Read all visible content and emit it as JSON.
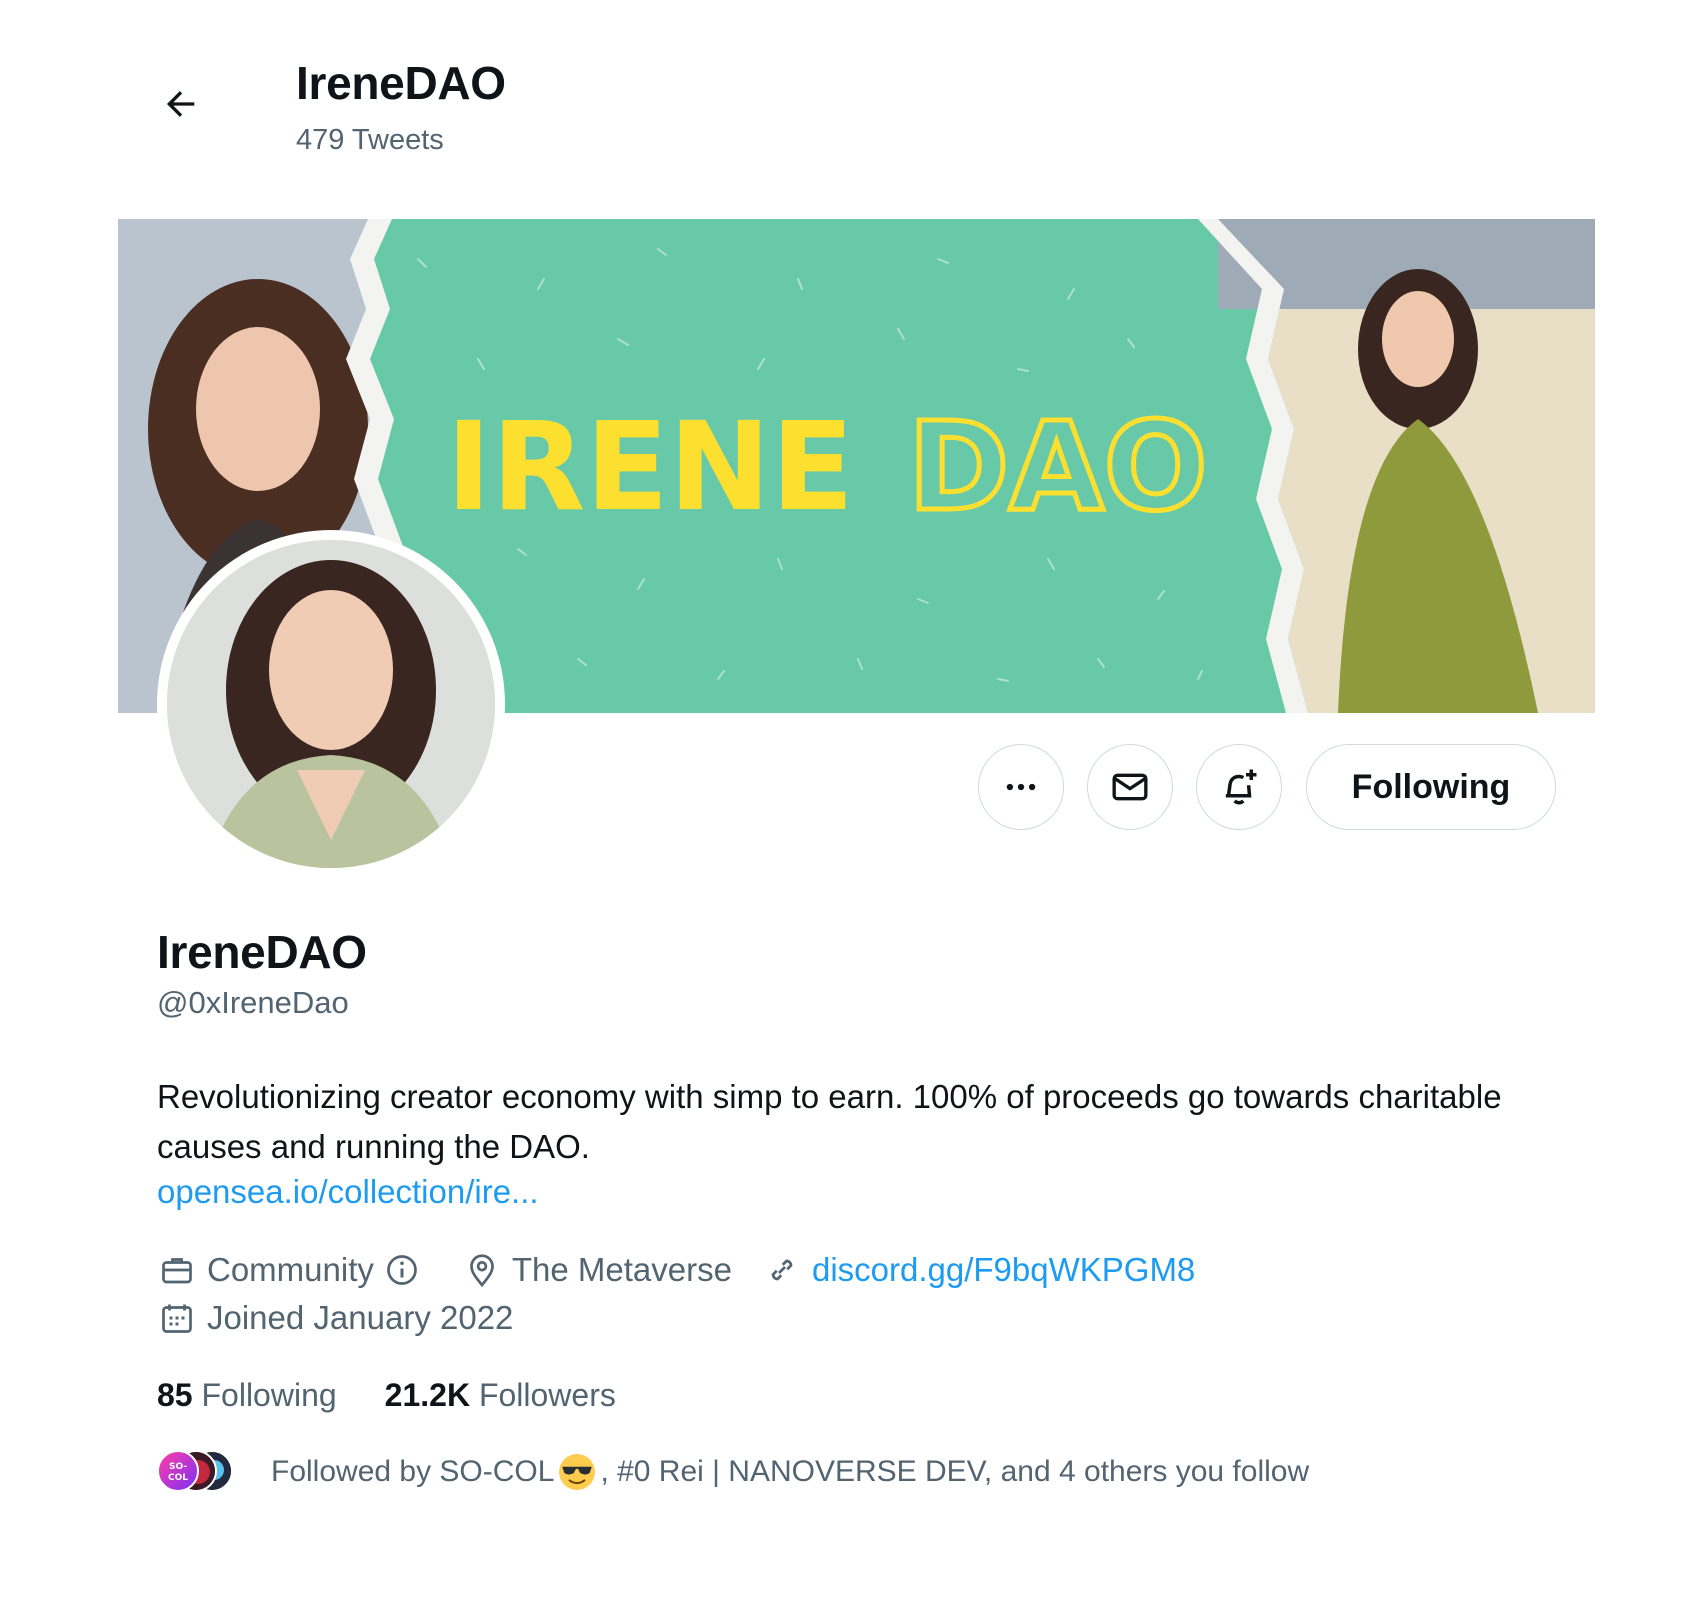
{
  "header": {
    "name": "IreneDAO",
    "tweet_count": "479 Tweets"
  },
  "banner": {
    "title_solid": "IRENE",
    "title_outline": "DAO",
    "colors": {
      "background": "#68c9a9",
      "title": "#fde02f"
    }
  },
  "actions": {
    "following_label": "Following"
  },
  "profile": {
    "name": "IreneDAO",
    "handle": "@0xIreneDao",
    "bio": "Revolutionizing creator economy with simp to earn. 100% of proceeds go towards charitable causes and running the DAO.",
    "bio_link": "opensea.io/collection/ire...",
    "category": "Community",
    "location": "The Metaverse",
    "website": "discord.gg/F9bqWKPGM8",
    "joined": "Joined January 2022"
  },
  "stats": {
    "following_count": "85",
    "following_label": "Following",
    "followers_count": "21.2K",
    "followers_label": "Followers"
  },
  "followed_by": {
    "prefix": "Followed by SO-COL",
    "suffix": ", #0 Rei | NANOVERSE DEV, and 4 others you follow",
    "mini_avatar_label": "SO-COL"
  },
  "colors": {
    "text": "#0f1419",
    "secondary": "#536471",
    "link": "#1d9bf0",
    "border": "#cfd9de"
  }
}
